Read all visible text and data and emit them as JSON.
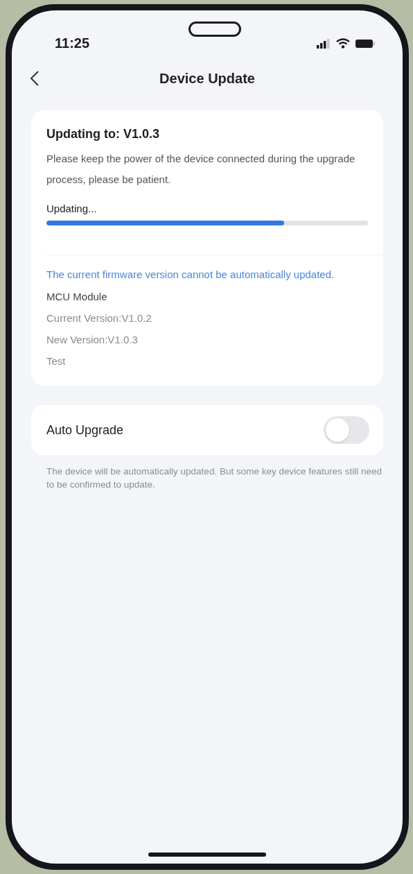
{
  "status_bar": {
    "time": "11:25"
  },
  "nav": {
    "title": "Device Update"
  },
  "update_card": {
    "heading": "Updating to: V1.0.3",
    "description": "Please keep the power of the device connected during the upgrade process, please be patient.",
    "progress": {
      "label": "Updating...",
      "level": 0.74
    },
    "notice": "The current firmware version cannot be automatically updated.",
    "details": [
      {
        "kind": "title",
        "text": "MCU Module"
      },
      {
        "kind": "line",
        "text": "Current Version:V1.0.2"
      },
      {
        "kind": "line",
        "text": "New Version:V1.0.3"
      },
      {
        "kind": "line",
        "text": "Test"
      }
    ]
  },
  "auto_upgrade": {
    "label": "Auto Upgrade",
    "on": false,
    "note": "The device will be automatically updated. But some key device features still need to be confirmed to update."
  }
}
